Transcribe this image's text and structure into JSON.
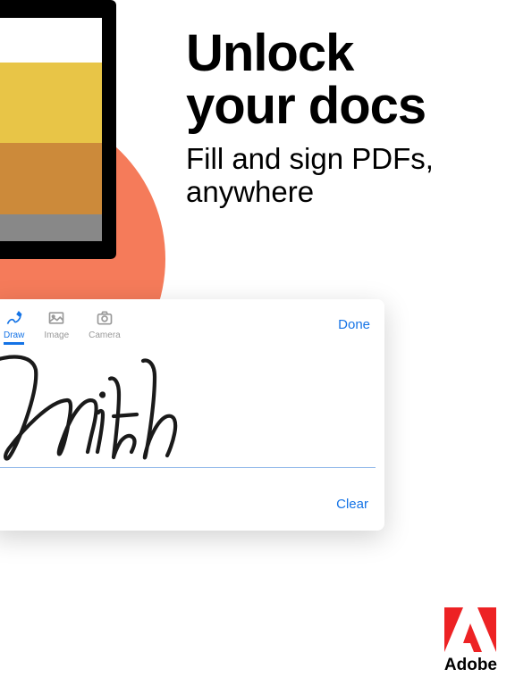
{
  "hero": {
    "headline_line1": "Unlock",
    "headline_line2": "your docs",
    "subhead_line1": "Fill and sign PDFs,",
    "subhead_line2": "anywhere"
  },
  "signature_panel": {
    "tools": {
      "draw": "Draw",
      "image": "Image",
      "camera": "Camera"
    },
    "done_label": "Done",
    "clear_label": "Clear",
    "signature_name": "Smith"
  },
  "brand": {
    "name": "Adobe",
    "logo_color": "#ed2224"
  },
  "accent": {
    "circle_color": "#f57b5a"
  }
}
